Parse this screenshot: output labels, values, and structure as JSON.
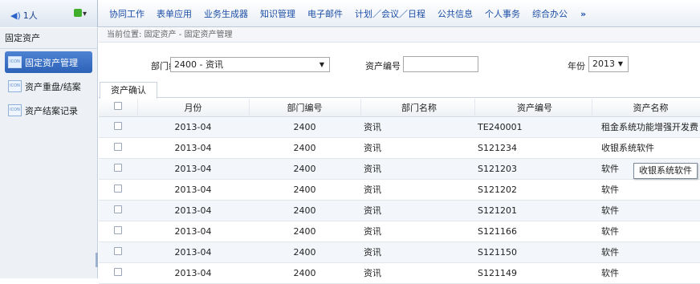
{
  "topbar": {
    "user_label": "1人",
    "status_icon": "check-icon",
    "nav_items": [
      "协同工作",
      "表单应用",
      "业务生成器",
      "知识管理",
      "电子邮件",
      "计划／会议／日程",
      "公共信息",
      "个人事务",
      "综合办公"
    ],
    "nav_more": "»"
  },
  "sidebar": {
    "title": "固定资产",
    "items": [
      {
        "icon": "ICON",
        "label": "固定资产管理",
        "active": true
      },
      {
        "icon": "ICON",
        "label": "资产重盘/结案",
        "active": false
      },
      {
        "icon": "ICON",
        "label": "资产结案记录",
        "active": false
      }
    ]
  },
  "breadcrumb": "当前位置:  固定资产 - 固定资产管理",
  "filters": {
    "dept_label": "部门编号",
    "dept_value": "2400 - 资讯",
    "asset_label": "资产编号",
    "asset_value": "",
    "year_label": "年份",
    "year_value": "2013"
  },
  "tabs": {
    "confirm": "资产确认"
  },
  "table": {
    "columns": [
      "月份",
      "部门编号",
      "部门名称",
      "资产编号",
      "资产名称"
    ],
    "rows": [
      [
        "2013-04",
        "2400",
        "资讯",
        "TE240001",
        "租金系统功能增强开发费"
      ],
      [
        "2013-04",
        "2400",
        "资讯",
        "S121234",
        "收银系统软件"
      ],
      [
        "2013-04",
        "2400",
        "资讯",
        "S121203",
        "软件"
      ],
      [
        "2013-04",
        "2400",
        "资讯",
        "S121202",
        "软件"
      ],
      [
        "2013-04",
        "2400",
        "资讯",
        "S121201",
        "软件"
      ],
      [
        "2013-04",
        "2400",
        "资讯",
        "S121166",
        "软件"
      ],
      [
        "2013-04",
        "2400",
        "资讯",
        "S121150",
        "软件"
      ],
      [
        "2013-04",
        "2400",
        "资讯",
        "S121149",
        "软件"
      ]
    ]
  },
  "tooltip": "收银系统软件",
  "colors": {
    "nav_text": "#1d4fa6",
    "active_item": "#2c62b8",
    "alt_row": "#f3f6fa"
  }
}
